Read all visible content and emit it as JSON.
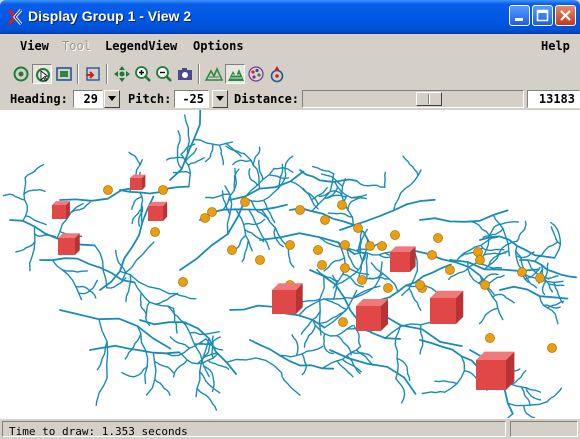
{
  "window": {
    "title": "Display Group 1 - View 2",
    "app_icon": "tntmips-x-icon",
    "buttons": [
      "minimize-icon",
      "maximize-icon",
      "close-icon"
    ]
  },
  "menu": {
    "view": "View",
    "tool": "Tool",
    "legendview": "LegendView",
    "options": "Options",
    "help": "Help"
  },
  "toolbar": {
    "icons": [
      "gadget-tool-icon",
      "select-tool-icon",
      "view-extents-icon",
      "add-layer-icon",
      "pan-icon",
      "zoom-in-icon",
      "zoom-out-icon",
      "snapshot-icon",
      "terrain-icon",
      "surface-icon",
      "color-palette-icon",
      "viewpoint-icon"
    ],
    "active": [
      "select-tool-icon",
      "surface-icon"
    ]
  },
  "controls": {
    "heading_label": "Heading:",
    "heading_value": "29",
    "pitch_label": "Pitch:",
    "pitch_value": "-25",
    "distance_label": "Distance:",
    "distance_value": "13183",
    "distance_slider_fraction": 0.58
  },
  "scene": {
    "stream_color": "#1a8bb8",
    "point_color": "#e8a010",
    "cube_color": "#e04848",
    "background": "#ffffff"
  },
  "status": {
    "text": "Time to draw: 1.353 seconds"
  }
}
